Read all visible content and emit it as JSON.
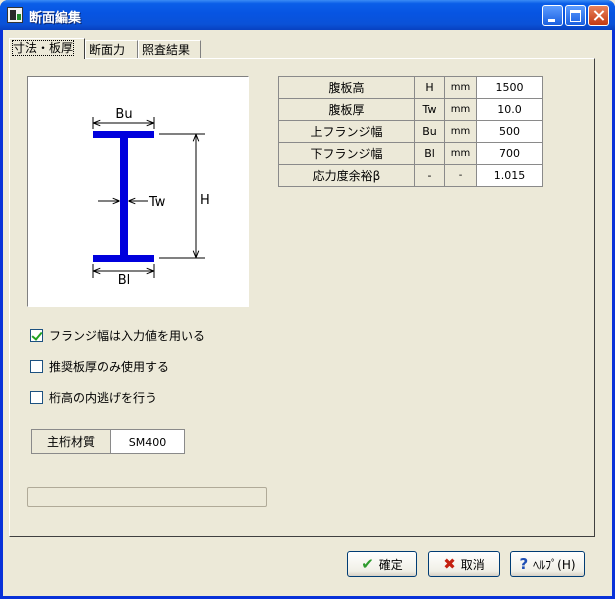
{
  "window": {
    "title": "断面編集"
  },
  "tabs": [
    {
      "label": "寸法・板厚",
      "active": true
    },
    {
      "label": "断面力",
      "active": false
    },
    {
      "label": "照査結果",
      "active": false
    }
  ],
  "diagram": {
    "labels": {
      "top_flange": "Bu",
      "web": "Tw",
      "height": "H",
      "bottom_flange": "Bl"
    },
    "colors": {
      "beam": "#0000dd",
      "dimension": "#000000"
    }
  },
  "params": {
    "rows": [
      {
        "name": "腹板高",
        "symbol": "H",
        "unit": "mm",
        "value": "1500"
      },
      {
        "name": "腹板厚",
        "symbol": "Tw",
        "unit": "mm",
        "value": "10.0"
      },
      {
        "name": "上フランジ幅",
        "symbol": "Bu",
        "unit": "mm",
        "value": "500"
      },
      {
        "name": "下フランジ幅",
        "symbol": "Bl",
        "unit": "mm",
        "value": "700"
      },
      {
        "name": "応力度余裕β",
        "symbol": "-",
        "unit": "-",
        "value": "1.015"
      }
    ]
  },
  "options": [
    {
      "label": "フランジ幅は入力値を用いる",
      "checked": true
    },
    {
      "label": "推奨板厚のみ使用する",
      "checked": false
    },
    {
      "label": "桁高の内逃げを行う",
      "checked": false
    }
  ],
  "material": {
    "label": "主桁材質",
    "value": "SM400"
  },
  "buttons": {
    "ok": "確定",
    "cancel": "取消",
    "help": "ﾍﾙﾌﾟ(H)"
  },
  "icons": {
    "ok": "check-icon",
    "cancel": "x-icon",
    "help": "question-icon",
    "ok_color": "#2e9b2e",
    "cancel_color": "#c42010",
    "help_color": "#1f4fb5"
  }
}
